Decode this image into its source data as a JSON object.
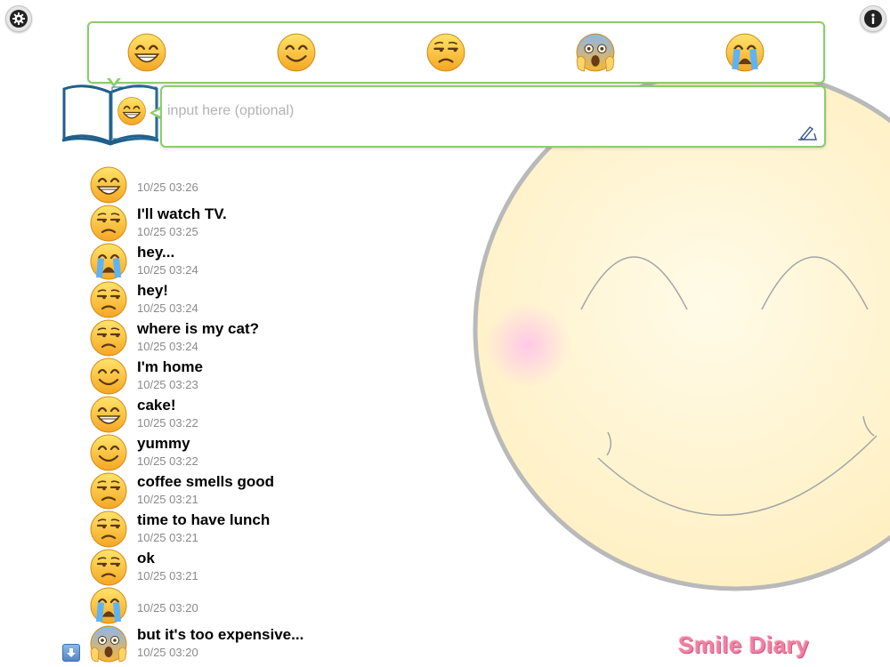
{
  "app": {
    "title": "Smile Diary"
  },
  "colors": {
    "accent_green": "#8ccc6b",
    "title_pink": "#f27fa2",
    "face_yellow": "#fff1c4"
  },
  "toolbar": {
    "settings_icon": "gear-icon",
    "info_icon": "info-icon"
  },
  "picker": {
    "emojis": [
      "grin",
      "smile",
      "unamused",
      "scream",
      "sob"
    ]
  },
  "composer": {
    "current_emoji": "grin",
    "placeholder": "input here (optional)",
    "submit_icon": "pen-icon"
  },
  "entries": [
    {
      "emoji": "grin",
      "text": "",
      "time": "10/25 03:26"
    },
    {
      "emoji": "unamused",
      "text": "I'll watch TV.",
      "time": "10/25 03:25"
    },
    {
      "emoji": "sob",
      "text": "hey...",
      "time": "10/25 03:24"
    },
    {
      "emoji": "unamused",
      "text": "hey!",
      "time": "10/25 03:24"
    },
    {
      "emoji": "unamused",
      "text": "where is my cat?",
      "time": "10/25 03:24"
    },
    {
      "emoji": "smile",
      "text": "I'm home",
      "time": "10/25 03:23"
    },
    {
      "emoji": "grin",
      "text": "cake!",
      "time": "10/25 03:22"
    },
    {
      "emoji": "smile",
      "text": "yummy",
      "time": "10/25 03:22"
    },
    {
      "emoji": "unamused",
      "text": "coffee smells good",
      "time": "10/25 03:21"
    },
    {
      "emoji": "unamused",
      "text": "time to have lunch",
      "time": "10/25 03:21"
    },
    {
      "emoji": "unamused",
      "text": "ok",
      "time": "10/25 03:21"
    },
    {
      "emoji": "sob",
      "text": "",
      "time": "10/25 03:20"
    },
    {
      "emoji": "scream",
      "text": "but it's too expensive...",
      "time": "10/25 03:20"
    }
  ],
  "scroll": {
    "icon": "arrow-down-icon"
  }
}
